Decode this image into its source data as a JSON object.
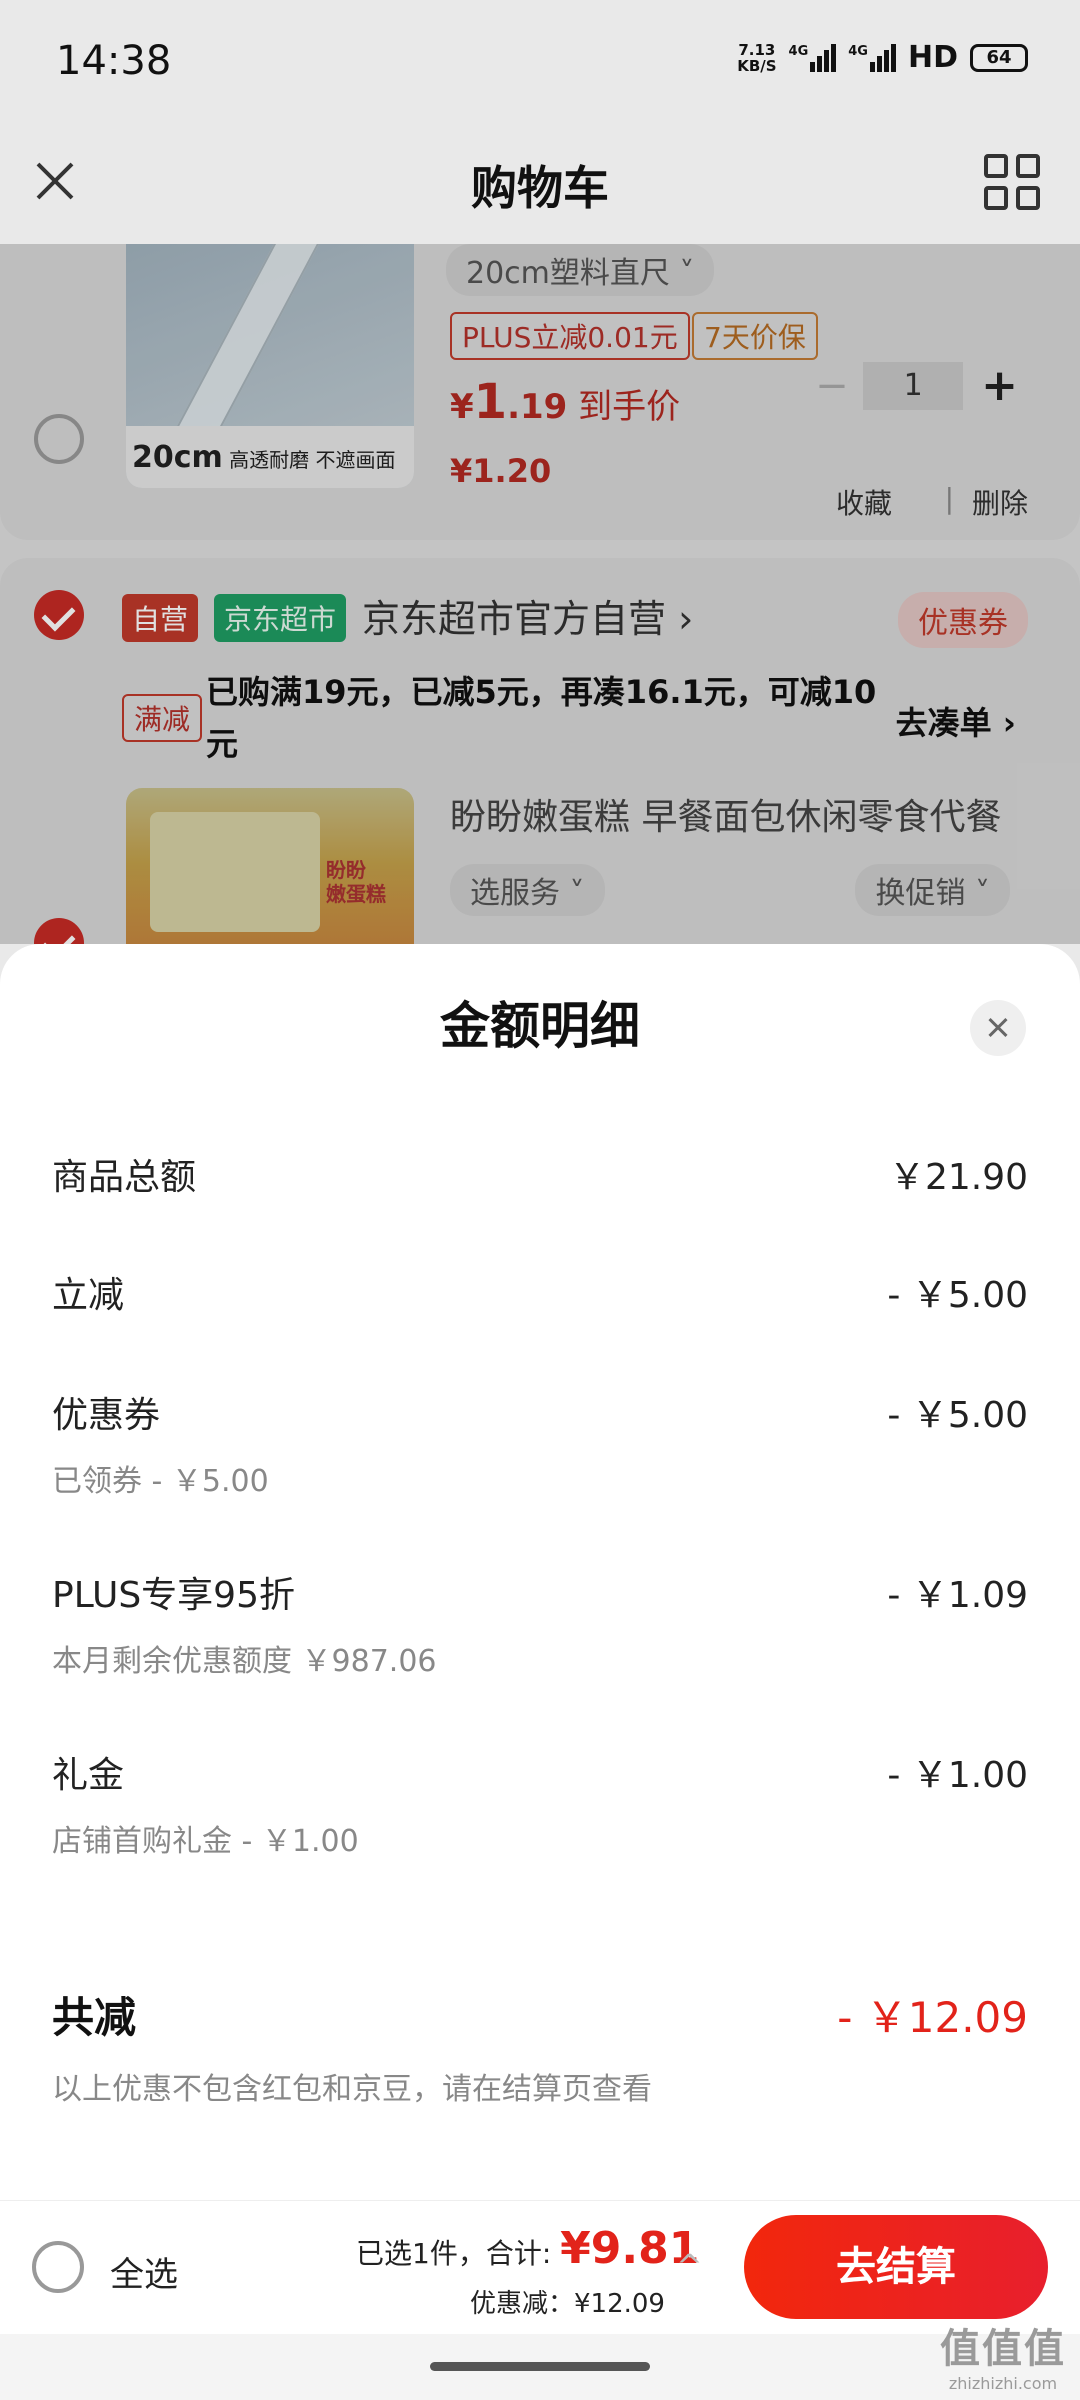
{
  "status_bar": {
    "time": "14:38",
    "speed_top": "7.13",
    "speed_unit": "KB/S",
    "net1": "4G",
    "net2": "4G",
    "hd": "HD",
    "battery": "64"
  },
  "header": {
    "title": "购物车"
  },
  "cart": {
    "item1": {
      "name": "20cm塑料直尺 ˅",
      "thumb_caption_big": "20cm",
      "thumb_caption_small": " 高透耐磨 不遮画面",
      "tag_plus": "PLUS立减0.01元",
      "tag_protect": "7天价保",
      "price_final_symbol": "¥",
      "price_final_int": "1",
      "price_final_dec": ".19",
      "price_final_label": " 到手价",
      "price_original": "¥1.20",
      "quantity": "1",
      "minus": "−",
      "plus": "+",
      "favorite": "收藏",
      "separator": "|",
      "delete": "删除"
    },
    "store": {
      "badge_self": "自营",
      "badge_supermarket": "京东超市",
      "name": "京东超市官方自营 ›",
      "coupon": "优惠券",
      "promo_tag": "满减",
      "promo_text": "已购满19元，已减5元，再凑16.1元，可减10元",
      "promo_go": "去凑单 ›"
    },
    "item2": {
      "name": "盼盼嫩蛋糕 早餐面包休闲零食代餐",
      "thumb_label": "盼盼\n嫩蛋糕",
      "service": "选服务 ˅",
      "promo": "换促销 ˅"
    }
  },
  "sheet": {
    "title": "金额明细",
    "rows": [
      {
        "label": "商品总额",
        "value": "￥21.90",
        "sub": ""
      },
      {
        "label": "立减",
        "value": "- ￥5.00",
        "sub": ""
      },
      {
        "label": "优惠券",
        "value": "- ￥5.00",
        "sub": "已领券 - ￥5.00"
      },
      {
        "label": "PLUS专享95折",
        "value": "- ￥1.09",
        "sub": "本月剩余优惠额度 ￥987.06"
      },
      {
        "label": "礼金",
        "value": "- ￥1.00",
        "sub": "店铺首购礼金 - ￥1.00"
      }
    ],
    "total": {
      "label": "共减",
      "value": "- ￥12.09",
      "note": "以上优惠不包含红包和京豆，请在结算页查看"
    }
  },
  "bottom_bar": {
    "select_all": "全选",
    "selected_prefix": "已选1件，合计: ",
    "amount": "¥9.81",
    "discount": "优惠减：¥12.09",
    "chevron": "^",
    "checkout": "去结算"
  },
  "watermark": {
    "big": "值值值",
    "small": "zhizhizhi.com"
  },
  "colors": {
    "accent": "#e2231a",
    "checkout": "#f2270c",
    "green_badge": "#1f9e63"
  }
}
